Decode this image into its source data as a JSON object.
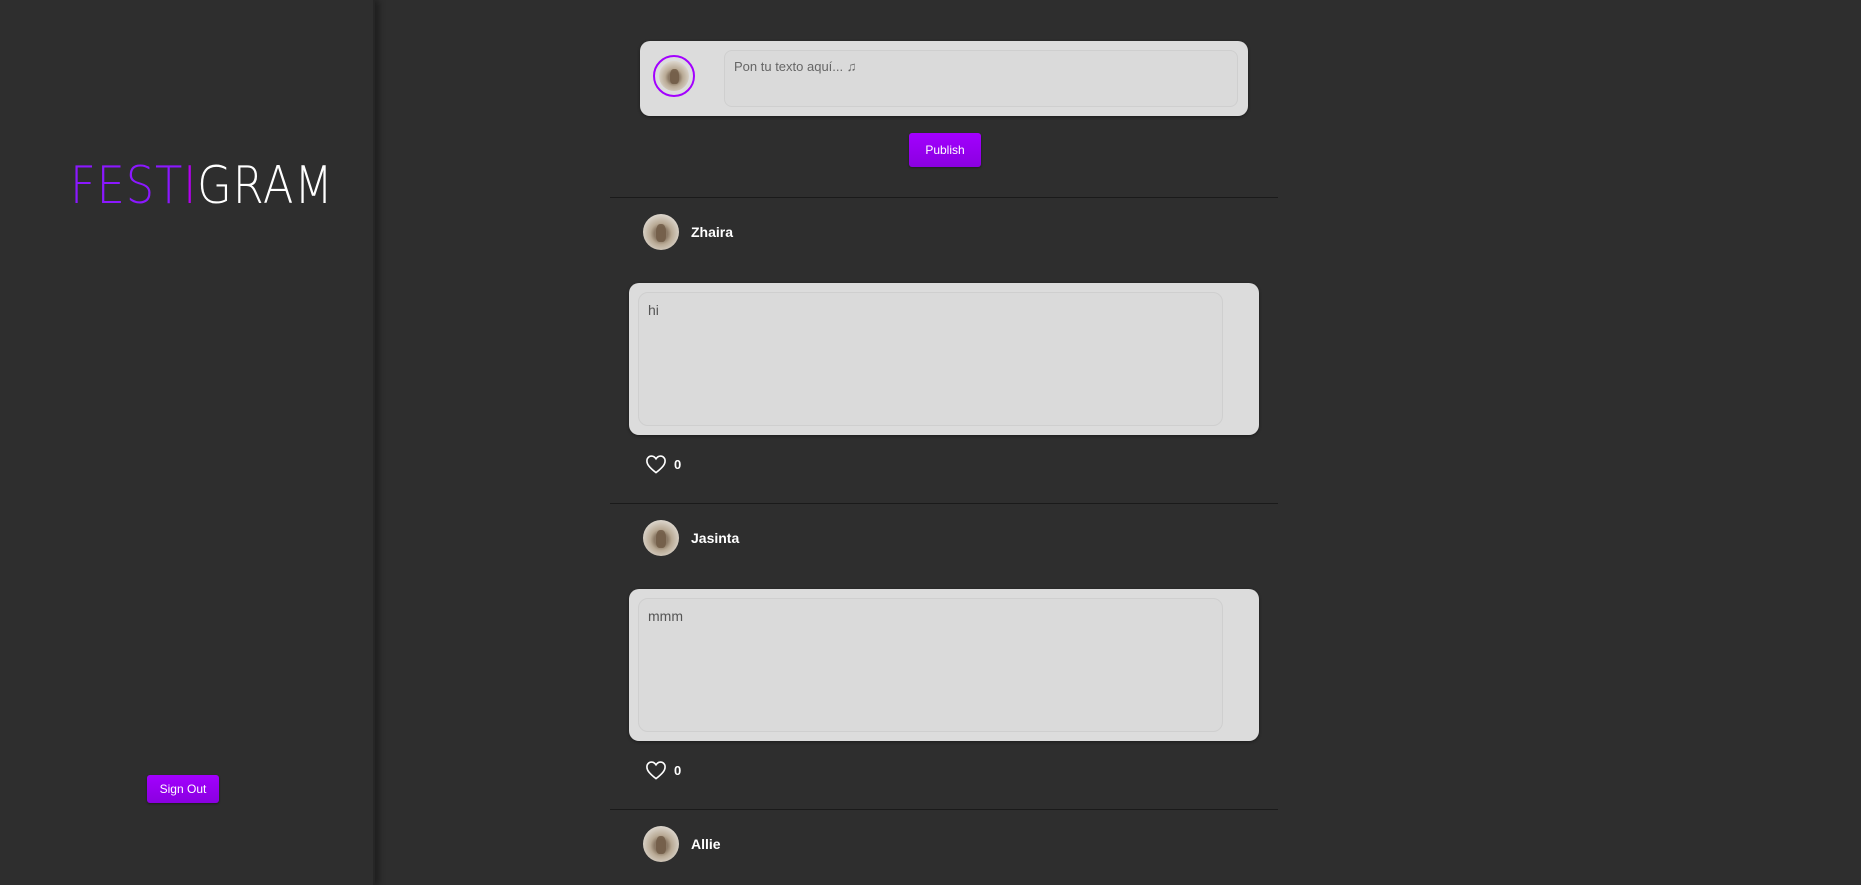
{
  "sidebar": {
    "logo": {
      "part1": "FEST",
      "part2": "I",
      "part3": "GRAM"
    },
    "sign_out_label": "Sign Out"
  },
  "composer": {
    "placeholder": "Pon tu texto aquí... ♫",
    "publish_label": "Publish"
  },
  "posts": [
    {
      "author": "Zhaira",
      "text": "hi",
      "likes": "0"
    },
    {
      "author": "Jasinta",
      "text": "mmm",
      "likes": "0"
    },
    {
      "author": "Allie"
    }
  ],
  "colors": {
    "background": "#2e2e2e",
    "accent": "#a300ff",
    "card": "#dcdcdc"
  },
  "icons": {
    "like": "heart-outline-icon",
    "avatar": "squirrel-avatar"
  }
}
